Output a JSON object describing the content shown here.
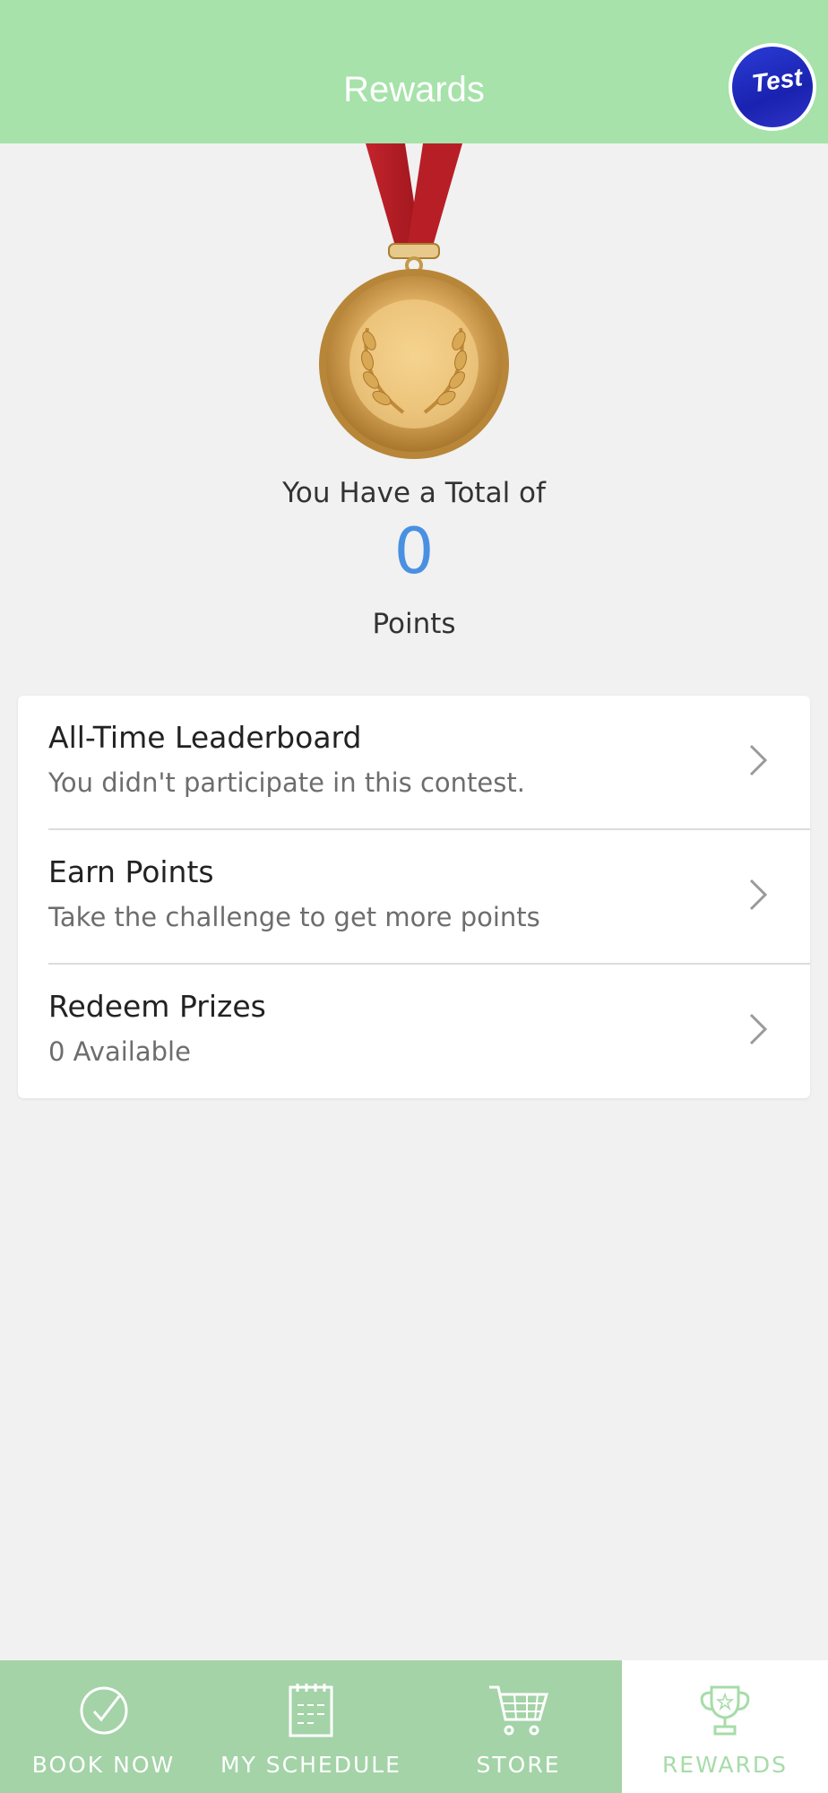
{
  "header": {
    "title": "Rewards",
    "avatar_text": "Test"
  },
  "summary": {
    "total_label": "You Have a Total of",
    "points_value": "0",
    "points_label": "Points"
  },
  "menu": [
    {
      "title": "All-Time Leaderboard",
      "subtitle": "You didn't participate in this contest."
    },
    {
      "title": "Earn Points",
      "subtitle": "Take the challenge to get more points"
    },
    {
      "title": "Redeem Prizes",
      "subtitle": "0 Available"
    }
  ],
  "tabs": [
    {
      "label": "BOOK NOW",
      "icon": "check-circle-icon"
    },
    {
      "label": "MY SCHEDULE",
      "icon": "calendar-icon"
    },
    {
      "label": "STORE",
      "icon": "cart-icon"
    },
    {
      "label": "REWARDS",
      "icon": "trophy-icon",
      "active": true
    }
  ],
  "colors": {
    "header_bg": "#a6e2a9",
    "tab_bg": "#a3d3a7",
    "points_blue": "#4a90e2",
    "active_tab_label": "#a6dca8"
  }
}
